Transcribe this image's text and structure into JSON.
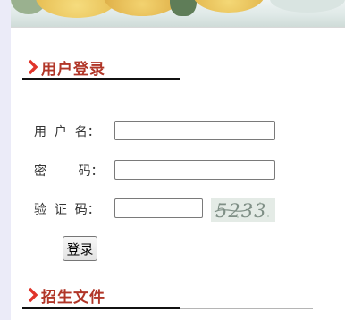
{
  "login_section": {
    "title": "用户登录",
    "username_label": "用  户  名：",
    "password_label": "密        码：",
    "captcha_label": "验  证  码：",
    "username_value": "",
    "password_value": "",
    "captcha_value": "",
    "captcha_text": "5233",
    "login_button_label": "登录"
  },
  "admissions_section": {
    "title": "招生文件"
  },
  "colors": {
    "heading": "#b13628",
    "chevron": "#e0342a",
    "rule": "#111111"
  },
  "icons": {
    "section_marker": "chevron-right-icon"
  }
}
